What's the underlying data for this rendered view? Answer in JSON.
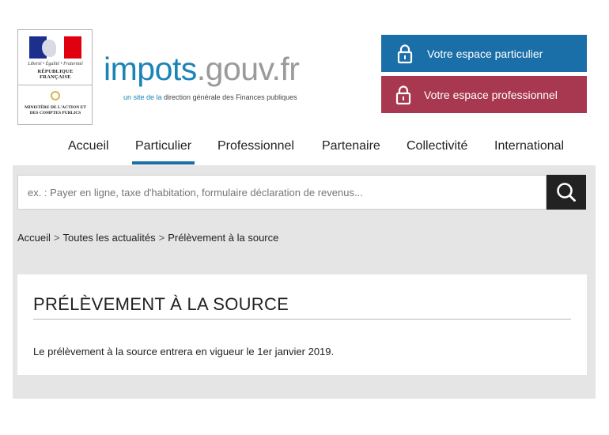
{
  "logo": {
    "motto": "Liberté • Égalité • Fraternité",
    "republic": "RÉPUBLIQUE FRANÇAISE",
    "ministry": "MINISTÈRE DE L'ACTION ET DES COMPTES PUBLICS",
    "brand_part1": "impots",
    "brand_part2": ".gouv.fr",
    "tagline_part1": "un site de la",
    "tagline_part2": " direction générale des Finances publiques"
  },
  "accounts": {
    "particulier": "Votre espace particulier",
    "professionnel": "Votre espace professionnel"
  },
  "nav": {
    "items": [
      "Accueil",
      "Particulier",
      "Professionnel",
      "Partenaire",
      "Collectivité",
      "International"
    ],
    "active": "Particulier"
  },
  "search": {
    "placeholder": "ex. : Payer en ligne, taxe d'habitation, formulaire déclaration de revenus..."
  },
  "breadcrumb": {
    "items": [
      "Accueil",
      "Toutes les actualités",
      "Prélèvement à la source"
    ],
    "separator": ">"
  },
  "article": {
    "title": "PRÉLÈVEMENT À LA SOURCE",
    "body": "Le prélèvement à la source entrera en vigueur le 1er janvier 2019."
  },
  "colors": {
    "brand_blue": "#1b84b6",
    "particulier_bg": "#1b6fa8",
    "pro_bg": "#a8384f",
    "search_button": "#222222"
  },
  "icons": {
    "account_icon": "lock-icon",
    "search_icon": "magnifier-icon"
  }
}
